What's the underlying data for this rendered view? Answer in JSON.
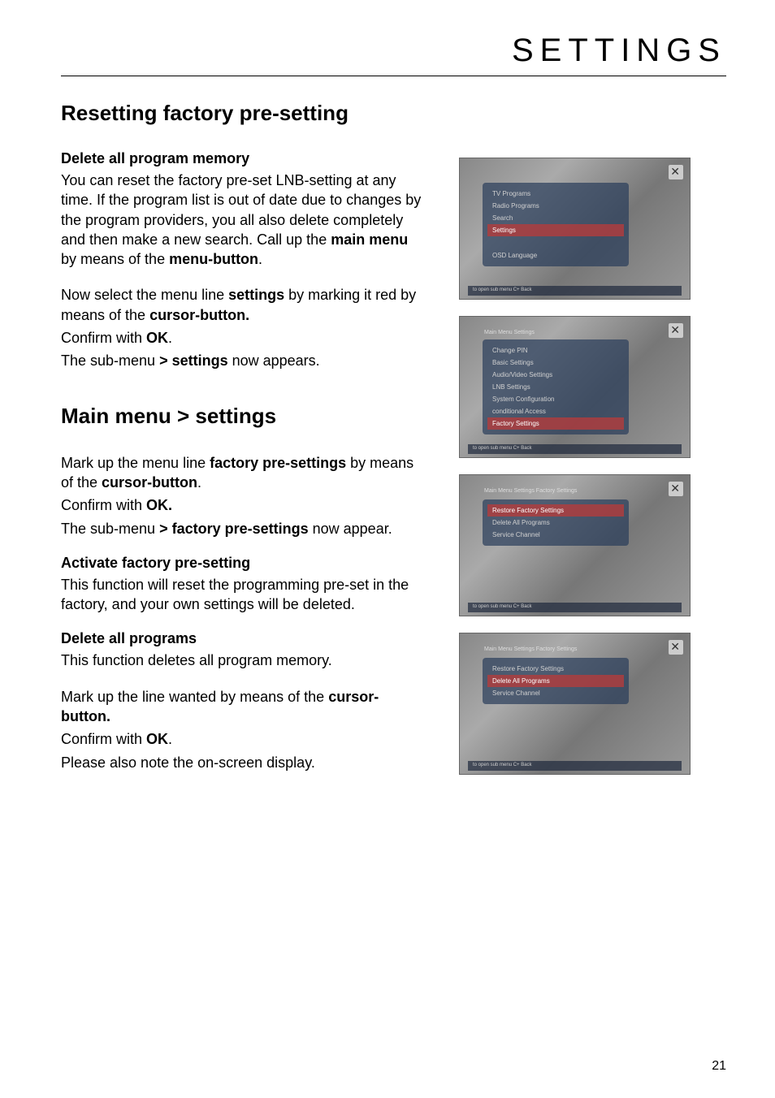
{
  "header": "SETTINGS",
  "h1": "Resetting factory pre-setting",
  "section1": {
    "heading": "Delete all program memory",
    "p1_a": "You can reset the factory pre-set LNB-setting at any time. If the program list is out of date due to changes by the program providers, you all also delete completely and then make a new search. Call up the ",
    "p1_b": "main menu",
    "p1_c": " by means of the ",
    "p1_d": "menu-button",
    "p1_e": ".",
    "p2_a": "Now select the menu line ",
    "p2_b": "settings",
    "p2_c": " by marking it red by means of the ",
    "p2_d": "cursor-button.",
    "p3_a": "Confirm with ",
    "p3_b": "OK",
    "p3_c": ".",
    "p4_a": "The sub-menu  ",
    "p4_b": "> settings",
    "p4_c": " now appears."
  },
  "h2": "Main menu > settings",
  "section2": {
    "p1_a": "Mark up the menu line ",
    "p1_b": "factory pre-settings",
    "p1_c": " by means of the ",
    "p1_d": "cursor-button",
    "p1_e": ".",
    "p2_a": "Confirm with ",
    "p2_b": "OK.",
    "p3_a": "The sub-menu ",
    "p3_b": "> factory pre-settings",
    "p3_c": " now appear."
  },
  "section3": {
    "heading": "Activate factory pre-setting",
    "p1": "This function will reset the programming pre-set in the factory, and your own settings will be deleted."
  },
  "section4": {
    "heading": "Delete all programs",
    "p1": "This function deletes all program memory.",
    "p2_a": "Mark up the line wanted by means of the ",
    "p2_b": "cursor-button.",
    "p3_a": "Confirm with ",
    "p3_b": "OK",
    "p3_c": ".",
    "p4": "Please also note the on-screen display."
  },
  "screenshots": {
    "s1": {
      "items": [
        "TV Programs",
        "Radio Programs",
        "Search",
        "Settings"
      ],
      "extra": "OSD Language",
      "footer": "to open sub menu  C+ Back"
    },
    "s2": {
      "title": "Main Menu Settings",
      "items": [
        "Change PIN",
        "Basic Settings",
        "Audio/Video Settings",
        "LNB Settings",
        "System Configuration",
        "conditional Access",
        "Factory Settings"
      ],
      "footer": "to open sub menu  C+ Back"
    },
    "s3": {
      "title": "Main Menu Settings  Factory Settings",
      "items": [
        "Restore Factory Settings",
        "Delete All Programs",
        "Service Channel"
      ],
      "footer": "to open sub menu  C+ Back"
    },
    "s4": {
      "title": "Main Menu Settings  Factory Settings",
      "items": [
        "Restore Factory Settings",
        "Delete All Programs",
        "Service Channel"
      ],
      "footer": "to open sub menu  C+ Back"
    }
  },
  "page_number": "21"
}
